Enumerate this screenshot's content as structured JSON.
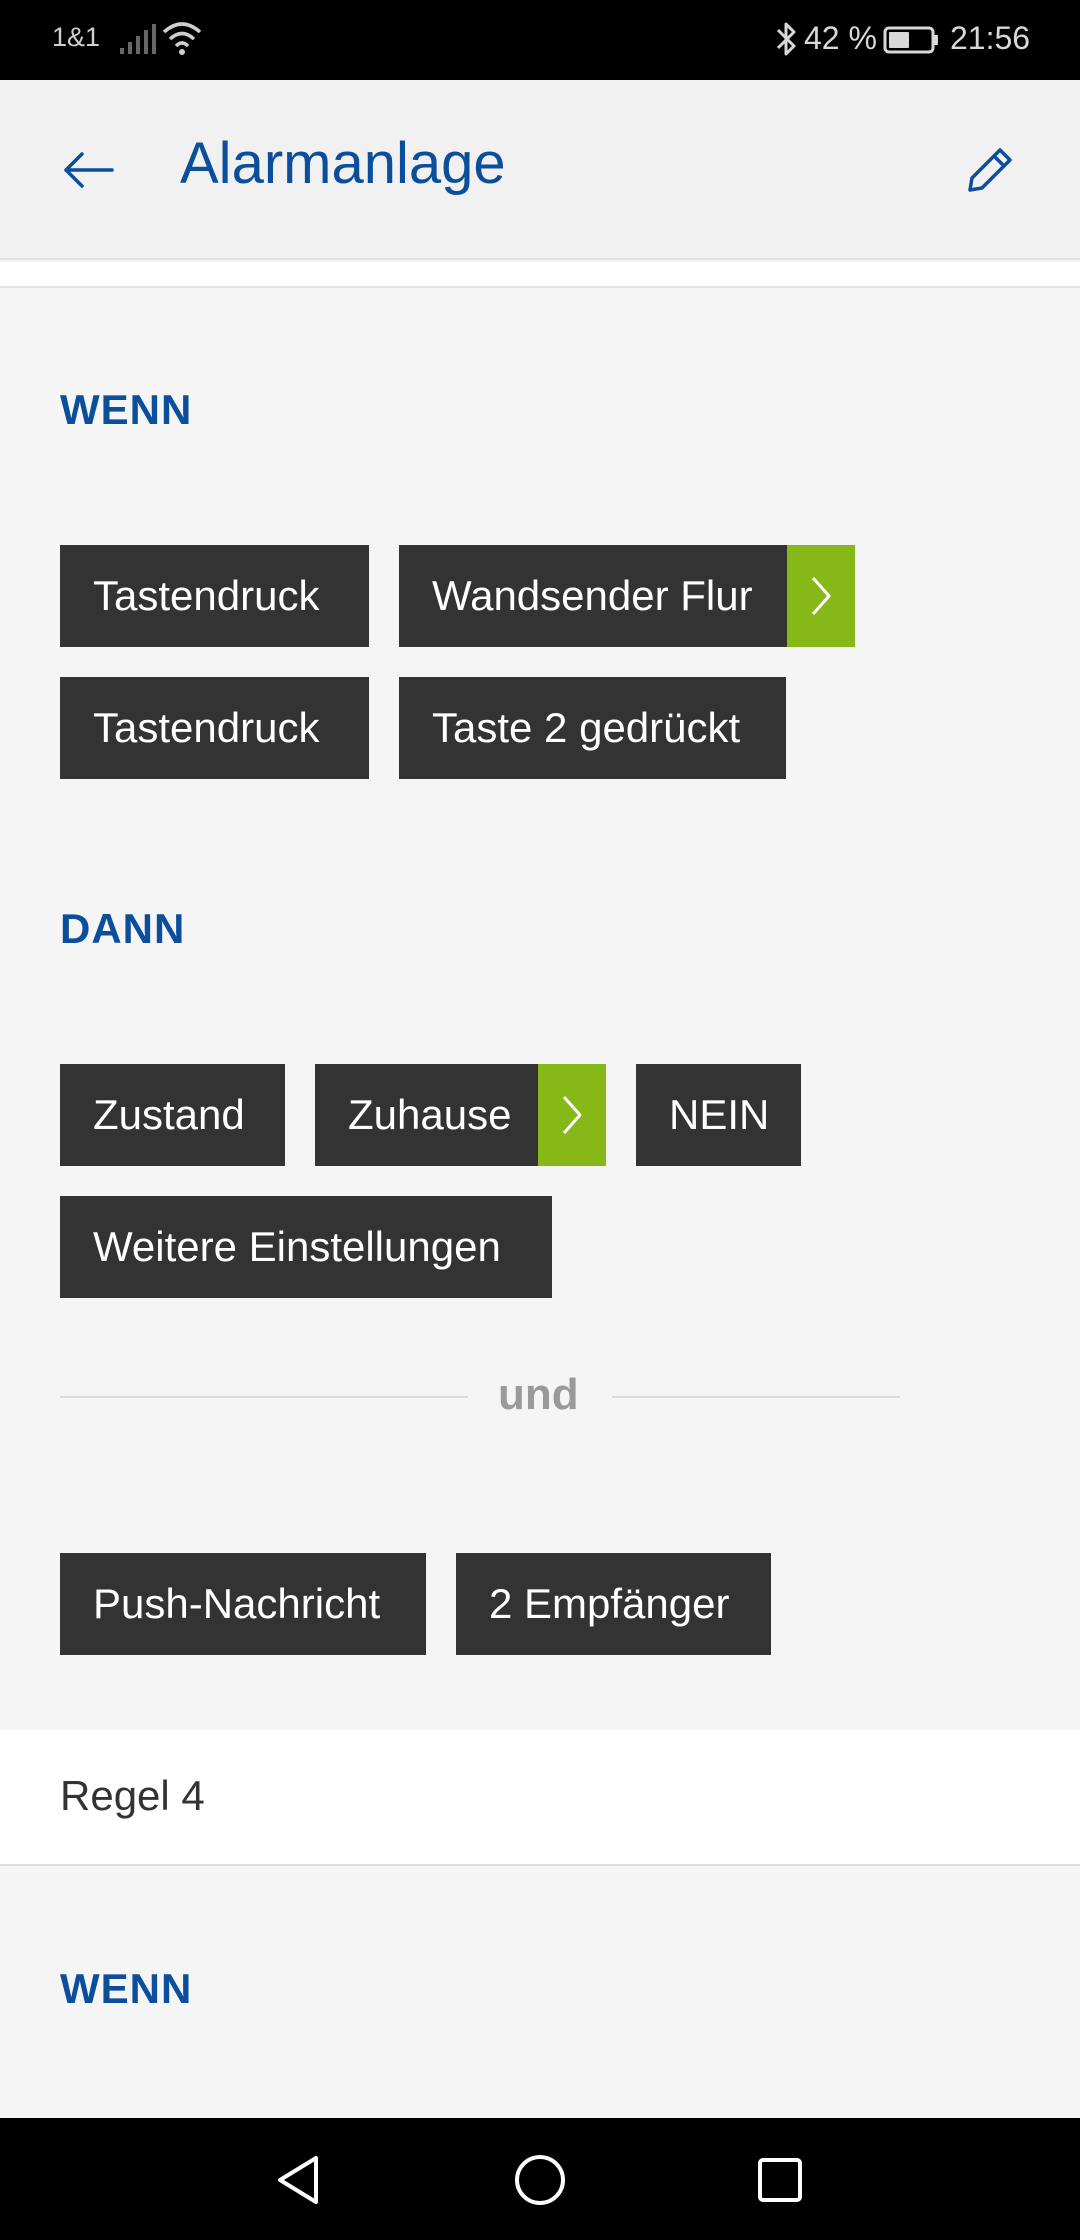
{
  "status_bar": {
    "carrier": "1&1",
    "battery": "42 %",
    "time": "21:56"
  },
  "app_bar": {
    "title": "Alarmanlage"
  },
  "rule": {
    "if_label": "WENN",
    "if_rows": [
      [
        "Tastendruck",
        "Wandsender Flur"
      ],
      [
        "Tastendruck",
        "Taste 2 gedrückt"
      ]
    ],
    "then_label": "DANN",
    "then_rows": [
      [
        "Zustand",
        "Zuhause",
        "NEIN"
      ],
      [
        "Weitere Einstellungen"
      ]
    ],
    "and_label": "und",
    "and_row": [
      "Push-Nachricht",
      "2 Empfänger"
    ]
  },
  "next_rule": {
    "title": "Regel 4",
    "if_label": "WENN"
  },
  "colors": {
    "accent_blue": "#0b4e9b",
    "chip_dark": "#333333",
    "chip_arrow_green": "#86b918"
  }
}
